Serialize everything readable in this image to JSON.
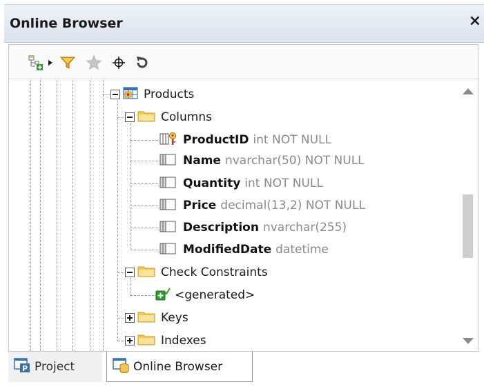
{
  "window": {
    "title": "Online Browser",
    "close_glyph": "×"
  },
  "toolbar": {
    "items": [
      {
        "name": "add-object-icon",
        "interactable": true
      },
      {
        "name": "dropdown-arrow-icon",
        "interactable": true
      },
      {
        "name": "filter-icon",
        "interactable": true
      },
      {
        "name": "favorites-star-icon",
        "interactable": true,
        "disabled": true
      },
      {
        "name": "locate-crosshair-icon",
        "interactable": true
      },
      {
        "name": "refresh-icon",
        "interactable": true
      }
    ]
  },
  "tree": {
    "products": {
      "label": "Products"
    },
    "columns": {
      "label": "Columns",
      "items": [
        {
          "name": "ProductID",
          "type": "int NOT NULL",
          "key": true
        },
        {
          "name": "Name",
          "type": "nvarchar(50) NOT NULL",
          "key": false
        },
        {
          "name": "Quantity",
          "type": "int NOT NULL",
          "key": false
        },
        {
          "name": "Price",
          "type": "decimal(13,2) NOT NULL",
          "key": false
        },
        {
          "name": "Description",
          "type": "nvarchar(255)",
          "key": false
        },
        {
          "name": "ModifiedDate",
          "type": "datetime",
          "key": false
        }
      ]
    },
    "check_constraints": {
      "label": "Check Constraints",
      "child": "<generated>"
    },
    "keys": {
      "label": "Keys"
    },
    "indexes": {
      "label": "Indexes"
    }
  },
  "tabs": [
    {
      "label": "Project",
      "active": false
    },
    {
      "label": "Online Browser",
      "active": true
    }
  ],
  "colors": {
    "folder": "#f2c64f",
    "accent_green": "#2e9b2e",
    "key_red": "#c0392b",
    "grid_blue": "#3a6fb0"
  }
}
